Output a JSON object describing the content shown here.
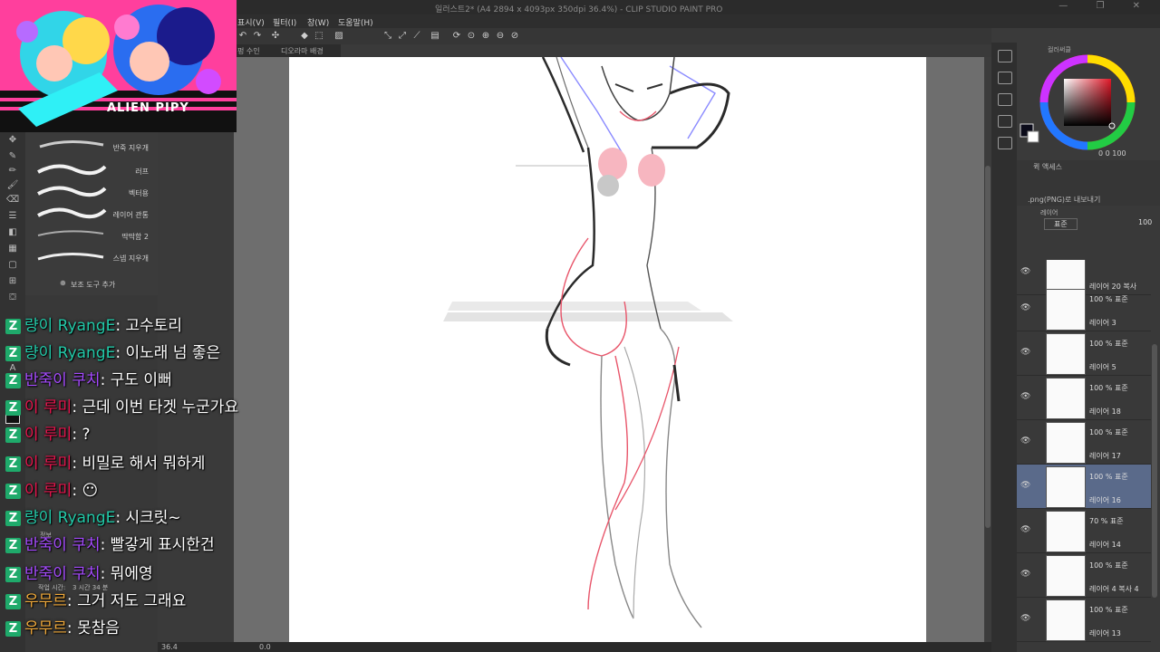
{
  "window": {
    "title": "일러스트2* (A4 2894 x 4093px 350dpi 36.4%) - CLIP STUDIO PAINT PRO",
    "controls": "—  ❐  ✕"
  },
  "menu": [
    "표시(V)",
    "필터(I)",
    "창(W)",
    "도움말(H)"
  ],
  "canvas_tabs": [
    "펑 수인",
    "디오라마 배경"
  ],
  "status": {
    "zoom": "36.4",
    "angle": "0.0"
  },
  "left_panel": {
    "brushes": [
      "반죽 지우개",
      "러프",
      "벡터용",
      "레이어 관통",
      "딱딱함 2",
      "스넵 지우개"
    ],
    "add_subtool": "보조 도구 추가",
    "info_title": "정보",
    "work_time_label": "작업 시간:",
    "work_time_value": "3 시간 34 분"
  },
  "overlay": {
    "logo": "ALIEN PIPY"
  },
  "chat": [
    {
      "nick": "량이 RyangE",
      "color": "#22c9a8",
      "text": "고수토리"
    },
    {
      "nick": "량이 RyangE",
      "color": "#22c9a8",
      "text": "이노래 넘 좋은"
    },
    {
      "nick": "반죽이 쿠치",
      "color": "#a64bff",
      "text": "구도 이뻐"
    },
    {
      "nick": "이 루미",
      "color": "#e8154e",
      "text": "근데 이번 타겟 누군가요"
    },
    {
      "nick": "이 루미",
      "color": "#e8154e",
      "text": "?"
    },
    {
      "nick": "이 루미",
      "color": "#e8154e",
      "text": "비밀로 해서 뭐하게"
    },
    {
      "nick": "이 루미",
      "color": "#e8154e",
      "text": "😶"
    },
    {
      "nick": "량이 RyangE",
      "color": "#22c9a8",
      "text": "시크릿~"
    },
    {
      "nick": "반죽이 쿠치",
      "color": "#a64bff",
      "text": "빨갛게 표시한건"
    },
    {
      "nick": "반죽이 쿠치",
      "color": "#a64bff",
      "text": "뭐에영"
    },
    {
      "nick": "우무르",
      "color": "#f0a93a",
      "text": "그거 저도 그래요"
    },
    {
      "nick": "우무르",
      "color": "#f0a93a",
      "text": "못참음"
    }
  ],
  "color_panel": {
    "title": "컬러써클",
    "readout": "0  0  100"
  },
  "nav_panel": {
    "title": "퀵 액세스",
    "item": ".png(PNG)로 내보내기"
  },
  "layer_panel": {
    "title": "레이어",
    "blend_mode": "표준",
    "opacity": "100",
    "layers": [
      {
        "name": "레이어 20 복사",
        "blend": "",
        "selected": false
      },
      {
        "name": "레이어 3",
        "blend": "100 % 표준",
        "selected": false
      },
      {
        "name": "레이어 5",
        "blend": "100 % 표준",
        "selected": false
      },
      {
        "name": "레이어 18",
        "blend": "100 % 표준",
        "selected": false
      },
      {
        "name": "레이어 17",
        "blend": "100 % 표준",
        "selected": false
      },
      {
        "name": "레이어 16",
        "blend": "100 % 표준",
        "selected": true
      },
      {
        "name": "레이어 14",
        "blend": "70 % 표준",
        "selected": false
      },
      {
        "name": "레이어 4 복사 4",
        "blend": "100 % 표준",
        "selected": false
      },
      {
        "name": "레이어 13",
        "blend": "100 % 표준",
        "selected": false
      }
    ]
  },
  "colors": {
    "sketch": "#2a2a2a",
    "red_line": "#e8556a",
    "blue_line": "#8a8aff",
    "selection": "#5a6a8a"
  }
}
